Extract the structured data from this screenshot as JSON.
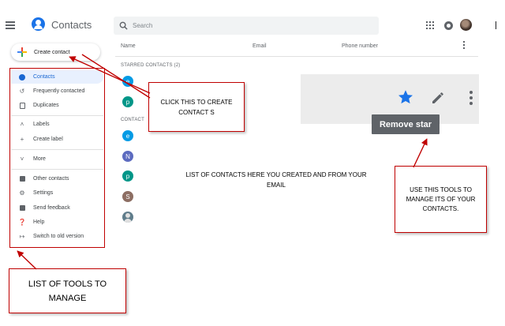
{
  "header": {
    "app_title": "Contacts",
    "search_placeholder": "Search"
  },
  "columns": {
    "name": "Name",
    "email": "Email",
    "phone": "Phone number"
  },
  "create_button_label": "Create contact",
  "sidebar": {
    "items": [
      {
        "label": "Contacts",
        "icon": "person-icon",
        "active": true
      },
      {
        "label": "Frequently contacted",
        "icon": "history-icon"
      },
      {
        "label": "Duplicates",
        "icon": "copy-icon"
      },
      {
        "label": "Labels",
        "icon": "chevron-up-icon"
      },
      {
        "label": "Create label",
        "icon": "plus-icon"
      },
      {
        "label": "More",
        "icon": "chevron-down-icon"
      },
      {
        "label": "Other contacts",
        "icon": "archive-icon"
      },
      {
        "label": "Settings",
        "icon": "gear-icon"
      },
      {
        "label": "Send feedback",
        "icon": "feedback-icon"
      },
      {
        "label": "Help",
        "icon": "help-icon"
      },
      {
        "label": "Switch to old version",
        "icon": "exit-icon"
      }
    ]
  },
  "list": {
    "starred_label": "STARRED CONTACTS (2)",
    "contacts_label": "CONTACT",
    "starred": [
      {
        "initial": "e",
        "color": "#039be5"
      },
      {
        "initial": "p",
        "color": "#009688"
      }
    ],
    "contacts": [
      {
        "initial": "e",
        "color": "#039be5"
      },
      {
        "initial": "N",
        "color": "#5c6bc0"
      },
      {
        "initial": "p",
        "color": "#009688"
      },
      {
        "initial": "S",
        "color": "#8d6e63"
      }
    ]
  },
  "row_actions": {
    "tooltip": "Remove star",
    "star_color": "#1a73e8"
  },
  "annotations": {
    "create": "CLICK THIS TO CREATE CONTACT S",
    "contacts_list": "LIST OF CONTACTS HERE YOU CREATED AND FROM YOUR EMAIL",
    "row_tools": "USE THIS TOOLS TO MANAGE ITS OF YOUR CONTACTS.",
    "sidebar_tools": "LIST OF TOOLS TO MANAGE",
    "color": "#c00000"
  }
}
